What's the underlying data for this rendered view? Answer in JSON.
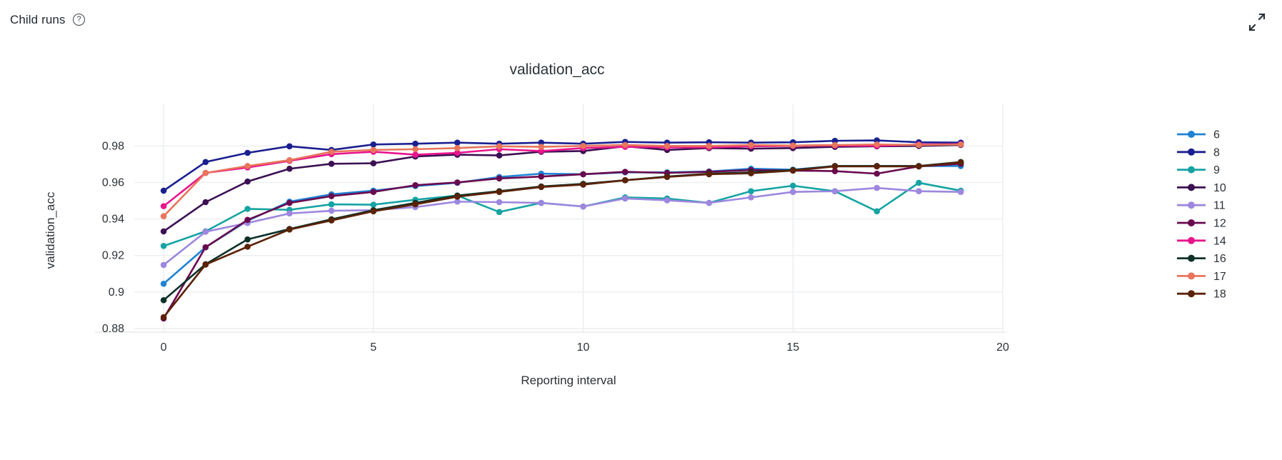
{
  "header": {
    "title": "Child runs",
    "help_icon": "question-mark-icon",
    "expand_icon": "expand-diagonal-arrows-icon"
  },
  "chart_data": {
    "type": "line",
    "title": "validation_acc",
    "xlabel": "Reporting interval",
    "ylabel": "validation_acc",
    "grid": true,
    "legend_position": "right",
    "xlim": [
      -0.7,
      20
    ],
    "ylim": [
      0.878,
      0.9895
    ],
    "xticks": [
      "0",
      "5",
      "10",
      "15",
      "20"
    ],
    "xtick_values": [
      0,
      5,
      10,
      15,
      20
    ],
    "yticks": [
      "0.88",
      "0.9",
      "0.92",
      "0.94",
      "0.96",
      "0.98"
    ],
    "ytick_values": [
      0.88,
      0.9,
      0.92,
      0.94,
      0.96,
      0.98
    ],
    "x": [
      0,
      1,
      2,
      3,
      4,
      5,
      6,
      7,
      8,
      9,
      10,
      11,
      12,
      13,
      14,
      15,
      16,
      17,
      18,
      19
    ],
    "series": [
      {
        "name": "6",
        "color": "#1f83d4",
        "values": [
          0.9045,
          0.9245,
          0.939,
          0.9495,
          0.9535,
          0.9555,
          0.958,
          0.9598,
          0.963,
          0.9648,
          0.9645,
          0.9655,
          0.9655,
          0.966,
          0.9675,
          0.967,
          0.969,
          0.969,
          0.969,
          0.969
        ]
      },
      {
        "name": "8",
        "color": "#1a1f8f",
        "values": [
          0.9555,
          0.9712,
          0.9762,
          0.9798,
          0.9778,
          0.9808,
          0.9812,
          0.9818,
          0.9812,
          0.9818,
          0.9812,
          0.9822,
          0.9818,
          0.982,
          0.9818,
          0.982,
          0.9828,
          0.983,
          0.982,
          0.9818
        ]
      },
      {
        "name": "9",
        "color": "#16a3a3",
        "values": [
          0.9252,
          0.9332,
          0.9455,
          0.945,
          0.948,
          0.9478,
          0.9505,
          0.9528,
          0.9438,
          0.9488,
          0.9468,
          0.9518,
          0.9512,
          0.9488,
          0.9552,
          0.9582,
          0.9552,
          0.9442,
          0.9598,
          0.9555
        ]
      },
      {
        "name": "10",
        "color": "#3c1053",
        "values": [
          0.9332,
          0.9492,
          0.9605,
          0.9675,
          0.9702,
          0.9705,
          0.9742,
          0.9752,
          0.9748,
          0.9768,
          0.9772,
          0.9798,
          0.9778,
          0.9788,
          0.9785,
          0.9788,
          0.9795,
          0.9798,
          0.98,
          0.9805
        ]
      },
      {
        "name": "11",
        "color": "#9d87df",
        "values": [
          0.9148,
          0.933,
          0.9378,
          0.943,
          0.9445,
          0.9448,
          0.9465,
          0.9495,
          0.9492,
          0.9488,
          0.9468,
          0.9512,
          0.9502,
          0.9488,
          0.9518,
          0.9548,
          0.9552,
          0.957,
          0.9552,
          0.9548
        ]
      },
      {
        "name": "12",
        "color": "#6a0a4e",
        "values": [
          0.8855,
          0.9245,
          0.9395,
          0.9488,
          0.9525,
          0.9548,
          0.9585,
          0.96,
          0.9622,
          0.9632,
          0.9645,
          0.9658,
          0.9652,
          0.9658,
          0.9668,
          0.9665,
          0.9662,
          0.9648,
          0.9688,
          0.9702
        ]
      },
      {
        "name": "14",
        "color": "#e8158c",
        "values": [
          0.947,
          0.9652,
          0.9682,
          0.9718,
          0.9755,
          0.9768,
          0.9752,
          0.9762,
          0.9782,
          0.9772,
          0.9788,
          0.9795,
          0.9792,
          0.9792,
          0.9798,
          0.98,
          0.9802,
          0.98,
          0.9808,
          0.981
        ]
      },
      {
        "name": "16",
        "color": "#0d3128",
        "values": [
          0.8955,
          0.9152,
          0.9288,
          0.9345,
          0.9398,
          0.9448,
          0.9488,
          0.9528,
          0.9552,
          0.9578,
          0.9592,
          0.9612,
          0.9632,
          0.9648,
          0.9655,
          0.9668,
          0.969,
          0.969,
          0.969,
          0.9712
        ]
      },
      {
        "name": "17",
        "color": "#e8755c",
        "values": [
          0.9415,
          0.9652,
          0.969,
          0.9722,
          0.9768,
          0.9778,
          0.9782,
          0.9788,
          0.9798,
          0.9795,
          0.98,
          0.9805,
          0.98,
          0.98,
          0.9805,
          0.9802,
          0.9805,
          0.9808,
          0.9805,
          0.9808
        ]
      },
      {
        "name": "18",
        "color": "#5b2207",
        "values": [
          0.8862,
          0.915,
          0.9248,
          0.9342,
          0.9392,
          0.9442,
          0.948,
          0.9522,
          0.9548,
          0.9575,
          0.9588,
          0.9612,
          0.963,
          0.9645,
          0.965,
          0.9665,
          0.9688,
          0.9688,
          0.9688,
          0.971
        ]
      }
    ]
  }
}
